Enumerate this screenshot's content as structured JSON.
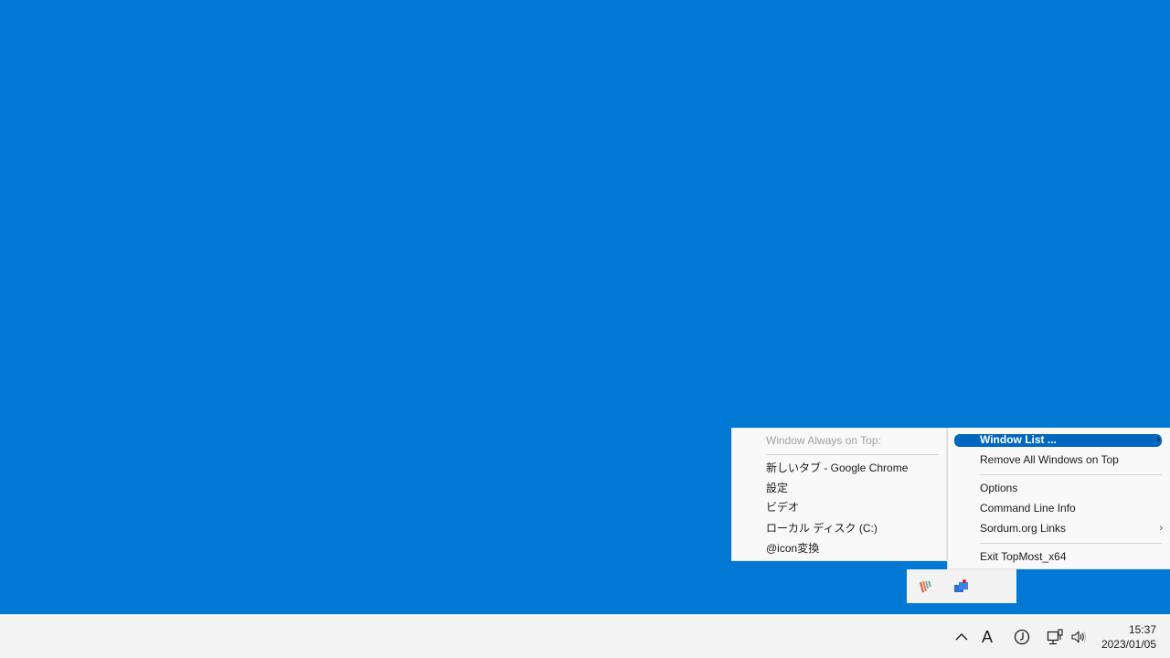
{
  "desktop": {
    "background": "#0078d4"
  },
  "window_menu": {
    "header": "Window Always on Top:",
    "items": [
      {
        "label": "新しいタブ - Google Chrome"
      },
      {
        "label": "設定"
      },
      {
        "label": "ビデオ"
      },
      {
        "label": "ローカル ディスク (C:)"
      },
      {
        "label": "@icon変換"
      }
    ]
  },
  "context_menu": {
    "items": [
      {
        "label": "Window List ...",
        "selected": true,
        "submenu": true
      },
      {
        "label": "Remove All Windows on Top"
      },
      {
        "label": "Options"
      },
      {
        "label": "Command Line Info"
      },
      {
        "label": "Sordum.org Links",
        "submenu": true
      },
      {
        "label": "Exit TopMost_x64"
      }
    ],
    "submenu_glyph": "›",
    "accent": "#0067c0"
  },
  "tray_flyout": {
    "icons": [
      {
        "name": "app-stripes-icon"
      },
      {
        "name": "topmost-app-icon"
      }
    ]
  },
  "taskbar": {
    "show_hidden_icons_glyph": "^",
    "ime_glyph": "A",
    "clock": {
      "time": "15:37",
      "date": "2023/01/05"
    }
  }
}
